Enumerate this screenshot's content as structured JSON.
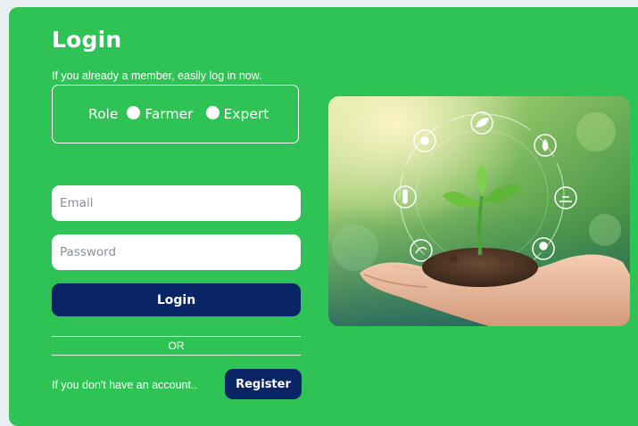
{
  "login": {
    "title": "Login",
    "subtitle": "If you already a member, easily log in now.",
    "role": {
      "label": "Role",
      "options": [
        "Farmer",
        "Expert"
      ]
    },
    "email_placeholder": "Email",
    "password_placeholder": "Password",
    "login_button": "Login",
    "divider_text": "OR",
    "no_account_text": "If you don't have an account..",
    "register_button": "Register"
  },
  "colors": {
    "background_green": "#2fc356",
    "button_navy": "#0a2566"
  },
  "hero_image": {
    "icons": [
      "sun-icon",
      "leaf-icon",
      "water-drop-icon",
      "tree-icon",
      "field-icon",
      "thermometer-icon",
      "recycle-icon",
      "seed-icon",
      "molecule-icon"
    ]
  }
}
